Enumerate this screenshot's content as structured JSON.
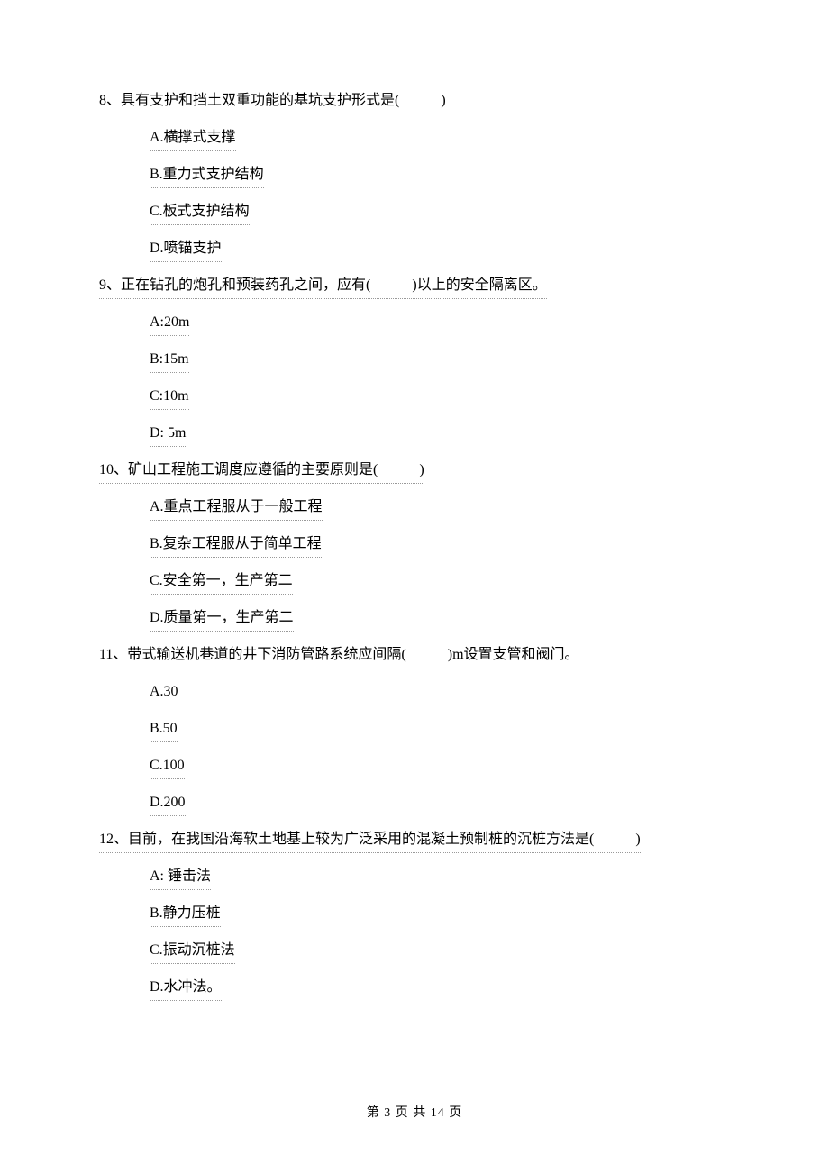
{
  "questions": [
    {
      "number": "8、",
      "text": "具有支护和挡土双重功能的基坑支护形式是(",
      "after": ")",
      "options": [
        "A.横撑式支撑",
        "B.重力式支护结构",
        "C.板式支护结构",
        "D.喷锚支护"
      ]
    },
    {
      "number": "9、",
      "text": "正在钻孔的炮孔和预装药孔之间，应有(",
      "after": ")以上的安全隔离区。",
      "options": [
        "A:20m",
        "B:15m",
        "C:10m",
        "D: 5m"
      ]
    },
    {
      "number": "10、",
      "text": "矿山工程施工调度应遵循的主要原则是(",
      "after": ")",
      "options": [
        "A.重点工程服从于一般工程",
        "B.复杂工程服从于简单工程",
        "C.安全第一，生产第二",
        "D.质量第一，生产第二"
      ]
    },
    {
      "number": "11、",
      "text": "带式输送机巷道的井下消防管路系统应间隔(",
      "after": ")m设置支管和阀门。",
      "options": [
        "A.30",
        "B.50",
        "C.100",
        "D.200"
      ]
    },
    {
      "number": "12、",
      "text": "目前，在我国沿海软土地基上较为广泛采用的混凝土预制桩的沉桩方法是(",
      "after": ")",
      "options": [
        "A: 锤击法",
        "B.静力压桩",
        "C.振动沉桩法",
        "D.水冲法。"
      ]
    }
  ],
  "footer": "第 3 页 共 14 页"
}
